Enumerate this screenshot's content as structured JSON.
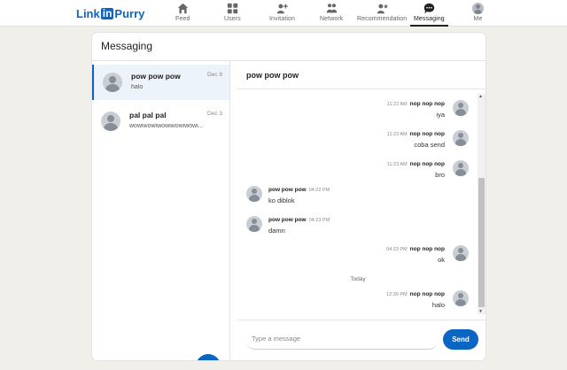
{
  "app": {
    "logo_left": "Link",
    "logo_box": "in",
    "logo_right": "Purry",
    "brand_color": "#0a66c2"
  },
  "nav": {
    "items": [
      {
        "label": "Feed",
        "icon": "home-icon"
      },
      {
        "label": "Users",
        "icon": "users-icon"
      },
      {
        "label": "Invitation",
        "icon": "add-person-icon"
      },
      {
        "label": "Network",
        "icon": "network-icon"
      },
      {
        "label": "Recommendation",
        "icon": "recommend-icon"
      },
      {
        "label": "Messaging",
        "icon": "chat-icon",
        "active": true
      },
      {
        "label": "Me",
        "icon": "avatar"
      }
    ]
  },
  "messaging": {
    "title": "Messaging",
    "conversations": [
      {
        "name": "pow pow pow",
        "date": "Dec 9",
        "preview": "halo",
        "selected": true
      },
      {
        "name": "pal pal pal",
        "date": "Dec 3",
        "preview": "wowiwowiwowiwowiwowi..."
      }
    ],
    "compose_label": "+"
  },
  "thread": {
    "title": "pow pow pow",
    "messages": [
      {
        "side": "right",
        "sender": "nop nop nop",
        "time": "11:22 AM",
        "text": "iya"
      },
      {
        "side": "right",
        "sender": "nop nop nop",
        "time": "11:23 AM",
        "text": "coba send"
      },
      {
        "side": "right",
        "sender": "nop nop nop",
        "time": "11:23 AM",
        "text": "bro"
      },
      {
        "side": "left",
        "sender": "pow pow pow",
        "time": "04:22 PM",
        "text": "ko diblok"
      },
      {
        "side": "left",
        "sender": "pow pow pow",
        "time": "04:23 PM",
        "text": "damn"
      },
      {
        "side": "right",
        "sender": "nop nop nop",
        "time": "04:23 PM",
        "text": "ok"
      },
      {
        "side": "right",
        "sender": "nop nop nop",
        "time": "12:30 PM",
        "text": "halo"
      }
    ],
    "day_separator": "Today",
    "input_placeholder": "Type a message",
    "send_label": "Send"
  }
}
